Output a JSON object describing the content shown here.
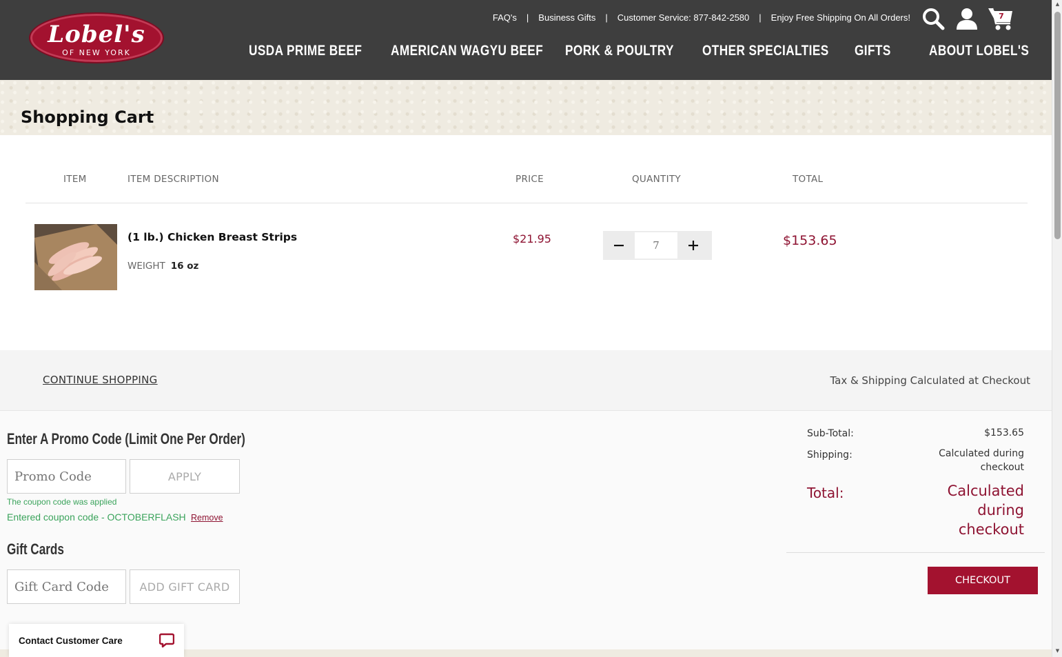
{
  "header": {
    "logo_main": "Lobel's",
    "logo_sub": "OF NEW YORK",
    "utility": {
      "faq": "FAQ's",
      "business_gifts": "Business Gifts",
      "customer_service": "Customer Service: 877-842-2580",
      "free_shipping": "Enjoy Free Shipping On All Orders!"
    },
    "cart_count": "7",
    "nav": [
      "USDA PRIME BEEF",
      "AMERICAN WAGYU BEEF",
      "PORK & POULTRY",
      "OTHER SPECIALTIES",
      "GIFTS",
      "ABOUT LOBEL'S"
    ]
  },
  "page_title": "Shopping Cart",
  "table": {
    "headers": {
      "item": "ITEM",
      "description": "ITEM DESCRIPTION",
      "price": "PRICE",
      "quantity": "QUANTITY",
      "total": "TOTAL"
    },
    "rows": [
      {
        "name": "(1 lb.) Chicken Breast Strips",
        "weight_label": "WEIGHT",
        "weight_value": "16 oz",
        "price": "$21.95",
        "quantity": "7",
        "total": "$153.65"
      }
    ]
  },
  "continue_shopping": "CONTINUE SHOPPING",
  "tax_note": "Tax & Shipping Calculated at Checkout",
  "promo": {
    "heading": "Enter A Promo Code (Limit One Per Order)",
    "placeholder": "Promo Code",
    "apply_label": "APPLY",
    "applied_msg": "The coupon code was applied",
    "entered_msg": "Entered coupon code - OCTOBERFLASH",
    "remove_label": "Remove"
  },
  "gift": {
    "heading": "Gift Cards",
    "placeholder": "Gift Card Code",
    "add_label": "ADD GIFT CARD"
  },
  "summary": {
    "subtotal_label": "Sub-Total:",
    "subtotal_value": "$153.65",
    "shipping_label": "Shipping:",
    "shipping_value": "Calculated during checkout",
    "total_label": "Total:",
    "total_value": "Calculated during checkout",
    "checkout_label": "CHECKOUT"
  },
  "chat": {
    "label": "Contact Customer Care"
  },
  "colors": {
    "header_bg": "#3e3e3e",
    "brand_red": "#a3122f",
    "price_red": "#8e1332",
    "success_green": "#3aa35b"
  }
}
